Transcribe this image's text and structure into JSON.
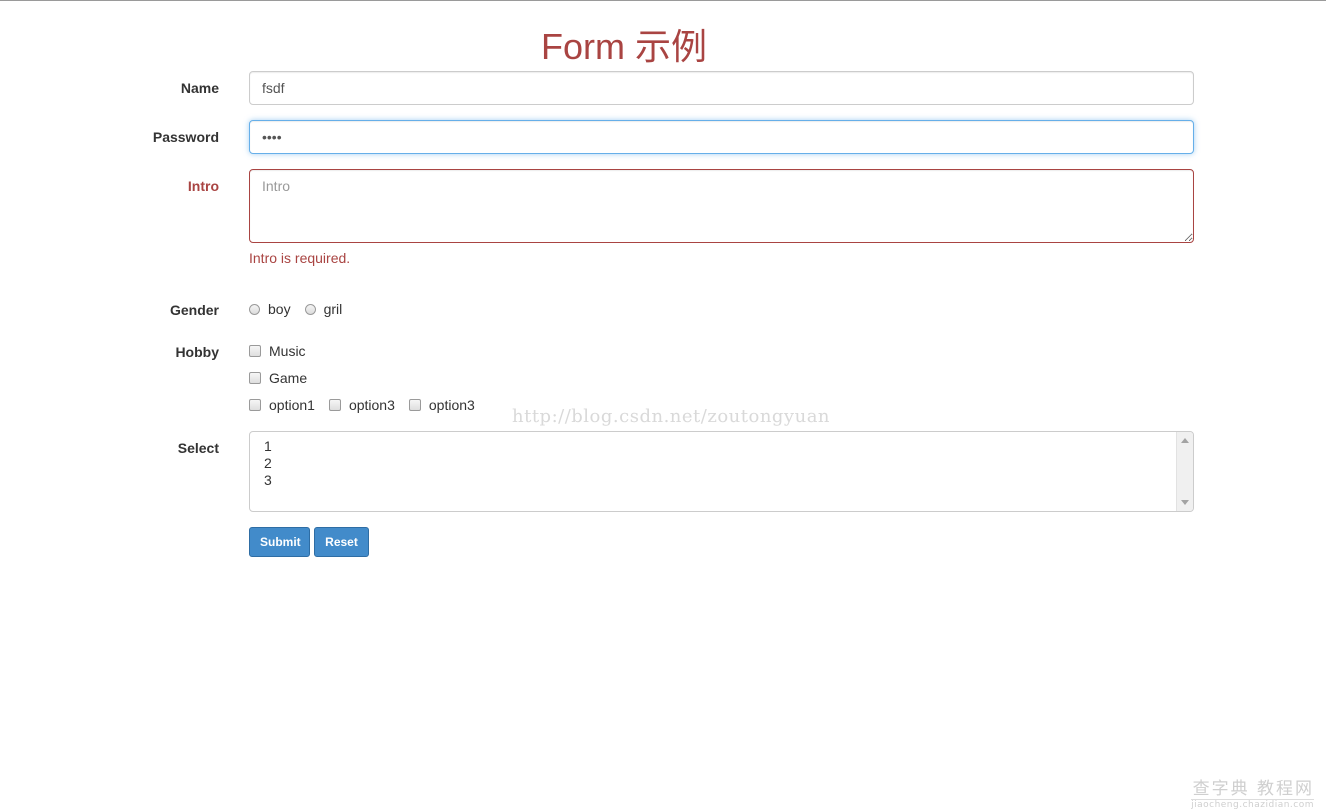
{
  "title": "Form 示例",
  "form": {
    "name": {
      "label": "Name",
      "value": "fsdf"
    },
    "password": {
      "label": "Password",
      "value": "••••"
    },
    "intro": {
      "label": "Intro",
      "placeholder": "Intro",
      "value": "",
      "error": "Intro is required."
    },
    "gender": {
      "label": "Gender",
      "options": [
        "boy",
        "gril"
      ]
    },
    "hobby": {
      "label": "Hobby",
      "options": [
        "Music",
        "Game",
        "option1",
        "option3",
        "option3"
      ]
    },
    "select": {
      "label": "Select",
      "options": [
        "1",
        "2",
        "3"
      ]
    },
    "buttons": {
      "submit": "Submit",
      "reset": "Reset"
    }
  },
  "colors": {
    "title": "#a94442",
    "error": "#a94442",
    "focus_border": "#66afe9",
    "button": "#428bca"
  },
  "watermark": "http://blog.csdn.net/zoutongyuan",
  "corner_logo": {
    "main": "查字典 教程网",
    "sub": "jiaocheng.chazidian.com"
  }
}
